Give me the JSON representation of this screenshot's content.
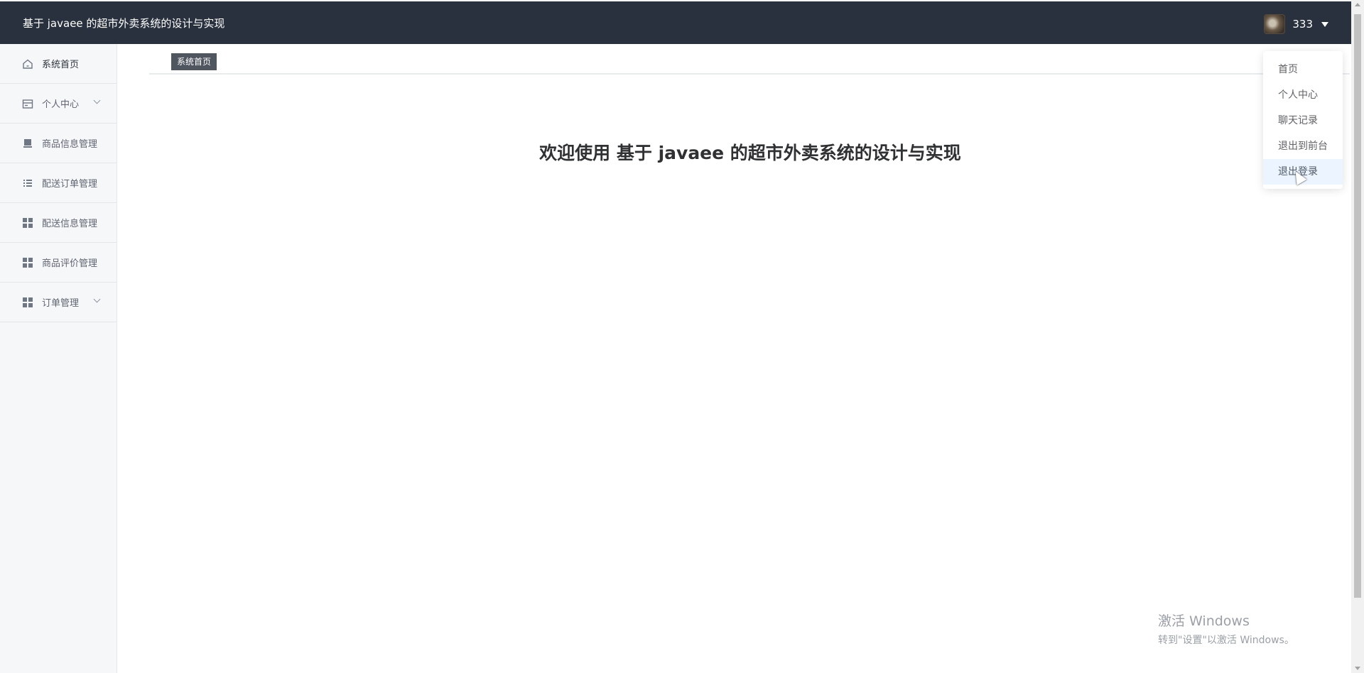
{
  "header": {
    "title": "基于 javaee 的超市外卖系统的设计与实现",
    "username": "333"
  },
  "sidebar": {
    "items": [
      {
        "label": "系统首页",
        "icon": "home-icon",
        "active": true
      },
      {
        "label": "个人中心",
        "icon": "card-icon",
        "expandable": true
      },
      {
        "label": "商品信息管理",
        "icon": "product-icon"
      },
      {
        "label": "配送订单管理",
        "icon": "list-icon"
      },
      {
        "label": "配送信息管理",
        "icon": "grid-icon"
      },
      {
        "label": "商品评价管理",
        "icon": "grid-icon"
      },
      {
        "label": "订单管理",
        "icon": "grid-icon",
        "expandable": true
      }
    ]
  },
  "breadcrumb": {
    "tag": "系统首页"
  },
  "main": {
    "welcome": "欢迎使用 基于 javaee 的超市外卖系统的设计与实现"
  },
  "user_menu": {
    "items": [
      "首页",
      "个人中心",
      "聊天记录",
      "退出到前台",
      "退出登录"
    ],
    "hovered": "退出登录"
  },
  "watermark": {
    "line1": "激活 Windows",
    "line2": "转到\"设置\"以激活 Windows。"
  },
  "colors": {
    "topbar": "#28313d",
    "sidebar": "#f6f7f9",
    "breadcrumb_tag": "#4f565f",
    "menu_hover": "#ecf5ff"
  }
}
